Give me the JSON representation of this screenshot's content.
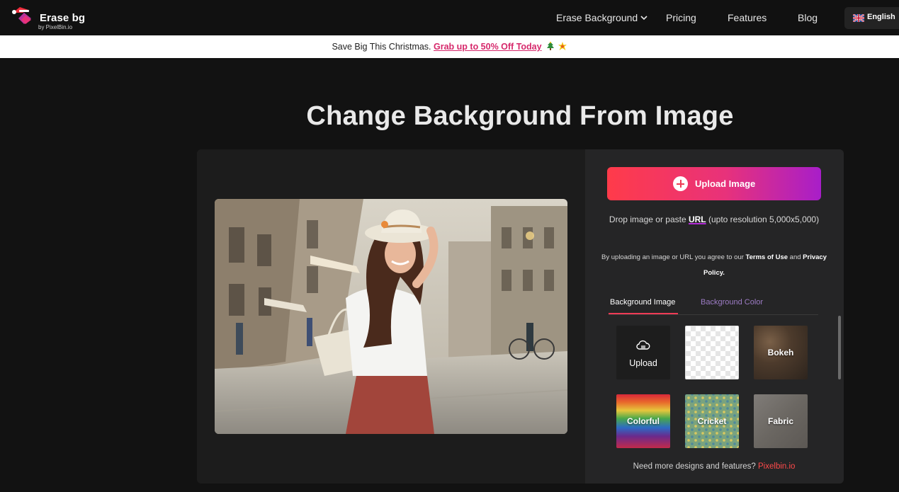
{
  "nav": {
    "logo_title": "Erase bg",
    "logo_sub": "by PixelBin.io",
    "links": [
      "Erase Background",
      "Pricing",
      "Features",
      "Blog"
    ],
    "language": "English"
  },
  "banner": {
    "text": "Save Big This Christmas. ",
    "link": "Grab up to 50% Off Today"
  },
  "hero": {
    "title": "Change Background From Image"
  },
  "uploader": {
    "button_label": "Upload Image",
    "drop_prefix": "Drop image or paste ",
    "drop_url": "URL",
    "drop_suffix": " (upto resolution 5,000x5,000)",
    "terms_prefix": "By uploading an image or URL you agree to our ",
    "terms_link": "Terms of Use",
    "terms_and": " and ",
    "privacy_link": "Privacy Policy."
  },
  "tabs": {
    "active": "Background Image",
    "inactive": "Background Color"
  },
  "tiles": {
    "upload": "Upload",
    "bokeh": "Bokeh",
    "colorful": "Colorful",
    "cricket": "Cricket",
    "fabric": "Fabric"
  },
  "footer": {
    "prefix": "Need more designs and features? ",
    "link": "Pixelbin.io"
  },
  "colors": {
    "accent_red": "#ef3b55",
    "accent_purple": "#a81ec9",
    "banner_link": "#d6286b"
  }
}
